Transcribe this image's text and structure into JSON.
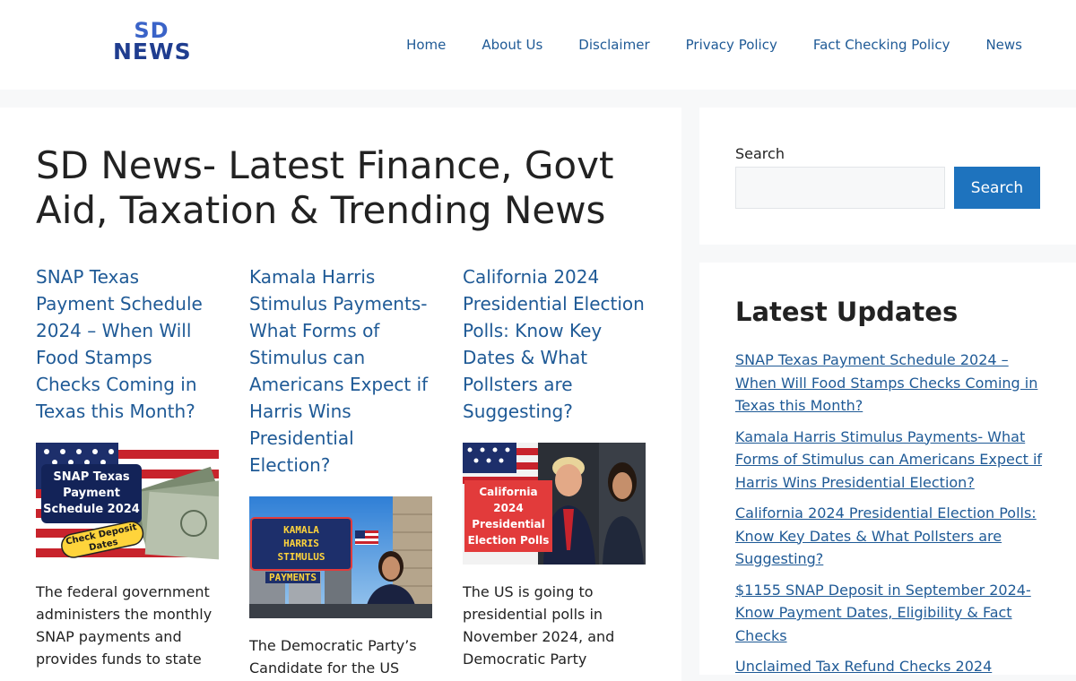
{
  "header": {
    "logo_line1": "SD",
    "logo_line2": "NEWS",
    "nav": [
      "Home",
      "About Us",
      "Disclaimer",
      "Privacy Policy",
      "Fact Checking Policy",
      "News"
    ]
  },
  "main": {
    "title": "SD News- Latest Finance, Govt Aid, Taxation & Trending News",
    "posts": [
      {
        "title": "SNAP Texas Payment Schedule 2024 – When Will Food Stamps Checks Coming in Texas this Month?",
        "thumb_text": "SNAP Texas Payment Schedule 2024",
        "thumb_badge": "Check Deposit Dates",
        "excerpt": "The federal government administers the monthly SNAP payments and provides funds to state"
      },
      {
        "title": "Kamala Harris Stimulus Payments- What Forms of Stimulus can Americans Expect if Harris Wins Presidential Election?",
        "thumb_text": "KAMALA HARRIS STIMULUS PAYMENTS",
        "excerpt": "The Democratic Party’s Candidate for the US President post, Kamala"
      },
      {
        "title": "California 2024 Presidential Election Polls: Know Key Dates & What Pollsters are Suggesting?",
        "thumb_text": "California 2024 Presidential Election Polls",
        "excerpt": "The US is going to presidential polls in November 2024, and Democratic Party"
      }
    ]
  },
  "sidebar": {
    "search_label": "Search",
    "search_button": "Search",
    "updates_title": "Latest Updates",
    "updates": [
      "SNAP Texas Payment Schedule 2024 – When Will Food Stamps Checks Coming in Texas this Month?",
      "Kamala Harris Stimulus Payments- What Forms of Stimulus can Americans Expect if Harris Wins Presidential Election?",
      "California 2024 Presidential Election Polls: Know Key Dates & What Pollsters are Suggesting?",
      "$1155 SNAP Deposit in September 2024- Know Payment Dates, Eligibility & Fact Checks",
      "Unclaimed Tax Refund Checks 2024"
    ]
  },
  "colors": {
    "link": "#1f5a96",
    "button": "#1e73be",
    "logo": "#1f3d8f"
  }
}
